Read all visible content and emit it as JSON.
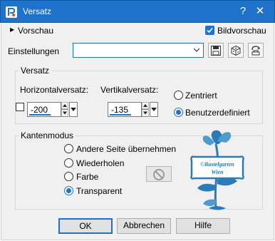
{
  "window": {
    "title": "Versatz",
    "help_glyph": "?",
    "close_glyph": "✕"
  },
  "preview": {
    "toggle_glyph": "▶",
    "label": "Vorschau",
    "image_preview_label": "Bildvorschau",
    "image_preview_checked": true
  },
  "settings": {
    "label": "Einstellungen",
    "value": ""
  },
  "offset_group": {
    "title": "Versatz",
    "horizontal_label": "Horizontalversatz:",
    "horizontal_value": "-200",
    "vertical_label": "Vertikalversatz:",
    "vertical_value": "-135",
    "options": [
      {
        "label": "Zentriert",
        "selected": false
      },
      {
        "label": "Benutzerdefiniert",
        "selected": true
      }
    ]
  },
  "edge_group": {
    "title": "Kantenmodus",
    "options": [
      {
        "label": "Andere Seite übernehmen",
        "selected": false
      },
      {
        "label": "Wiederholen",
        "selected": false
      },
      {
        "label": "Farbe",
        "selected": false
      },
      {
        "label": "Transparent",
        "selected": true
      }
    ]
  },
  "watermark": {
    "text_line1": "©Bastelgarten",
    "text_line2": "Wien"
  },
  "buttons": {
    "ok": "OK",
    "cancel": "Abbrechen",
    "help": "Hilfe"
  },
  "colors": {
    "accent": "#1e72c9",
    "dialog_bg": "#f0f0f0",
    "watermark": "#2a7bb8"
  }
}
